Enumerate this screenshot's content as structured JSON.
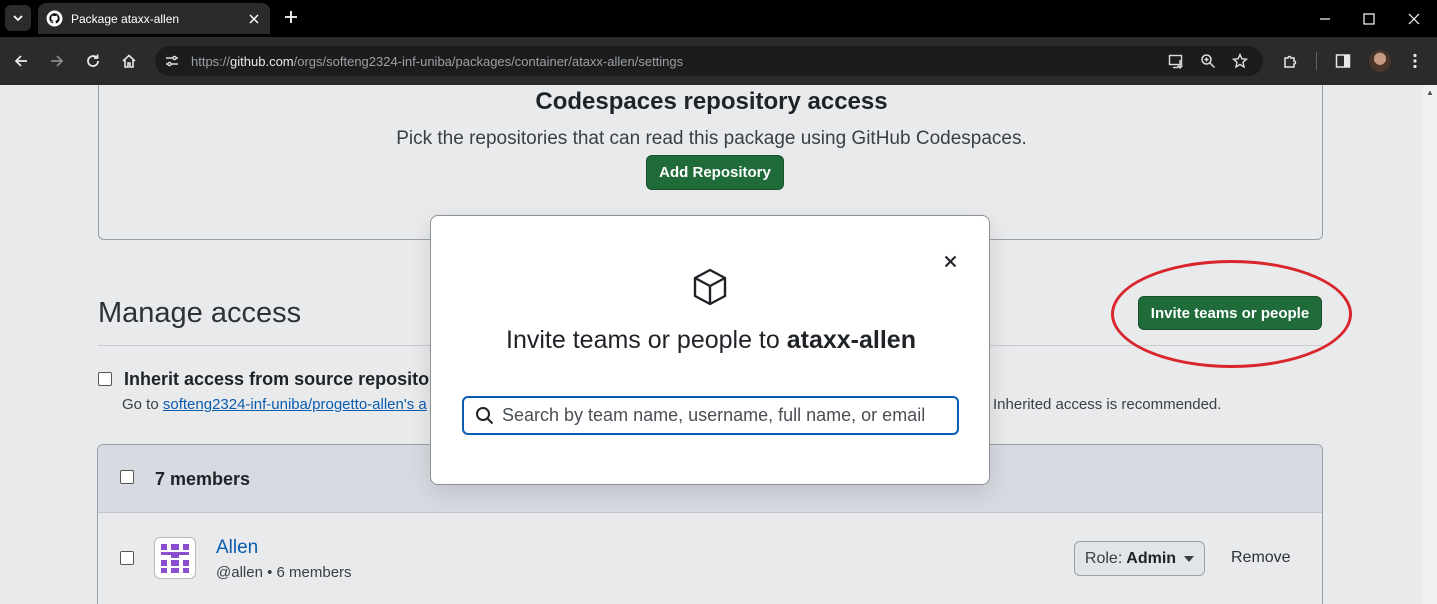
{
  "browser": {
    "tab_title": "Package ataxx-allen",
    "url_prefix": "https://",
    "url_host": "github.com",
    "url_path": "/orgs/softeng2324-inf-uniba/packages/container/ataxx-allen/settings"
  },
  "codespaces": {
    "title": "Codespaces repository access",
    "description": "Pick the repositories that can read this package using GitHub Codespaces.",
    "add_button": "Add Repository"
  },
  "manage": {
    "title": "Manage access",
    "invite_button": "Invite teams or people",
    "inherit_label_visible": "Inherit access from source repository (r",
    "inherit_help_prefix": "Go to ",
    "inherit_help_link": "softeng2324-inf-uniba/progetto-allen's a",
    "inherit_recommended": "Inherited access is recommended."
  },
  "members": {
    "count_label": "7 members",
    "rows": [
      {
        "name": "Allen",
        "sub": "@allen • 6 members",
        "role_prefix": "Role:",
        "role_value": "Admin",
        "remove_label": "Remove"
      }
    ]
  },
  "modal": {
    "heading_prefix": "Invite teams or people to ",
    "heading_package": "ataxx-allen",
    "search_placeholder": "Search by team name, username, full name, or email",
    "search_value": ""
  },
  "colors": {
    "primary_button": "#1f6b3a",
    "annotation_ellipse": "#d9262d",
    "link": "#0b5cad"
  }
}
